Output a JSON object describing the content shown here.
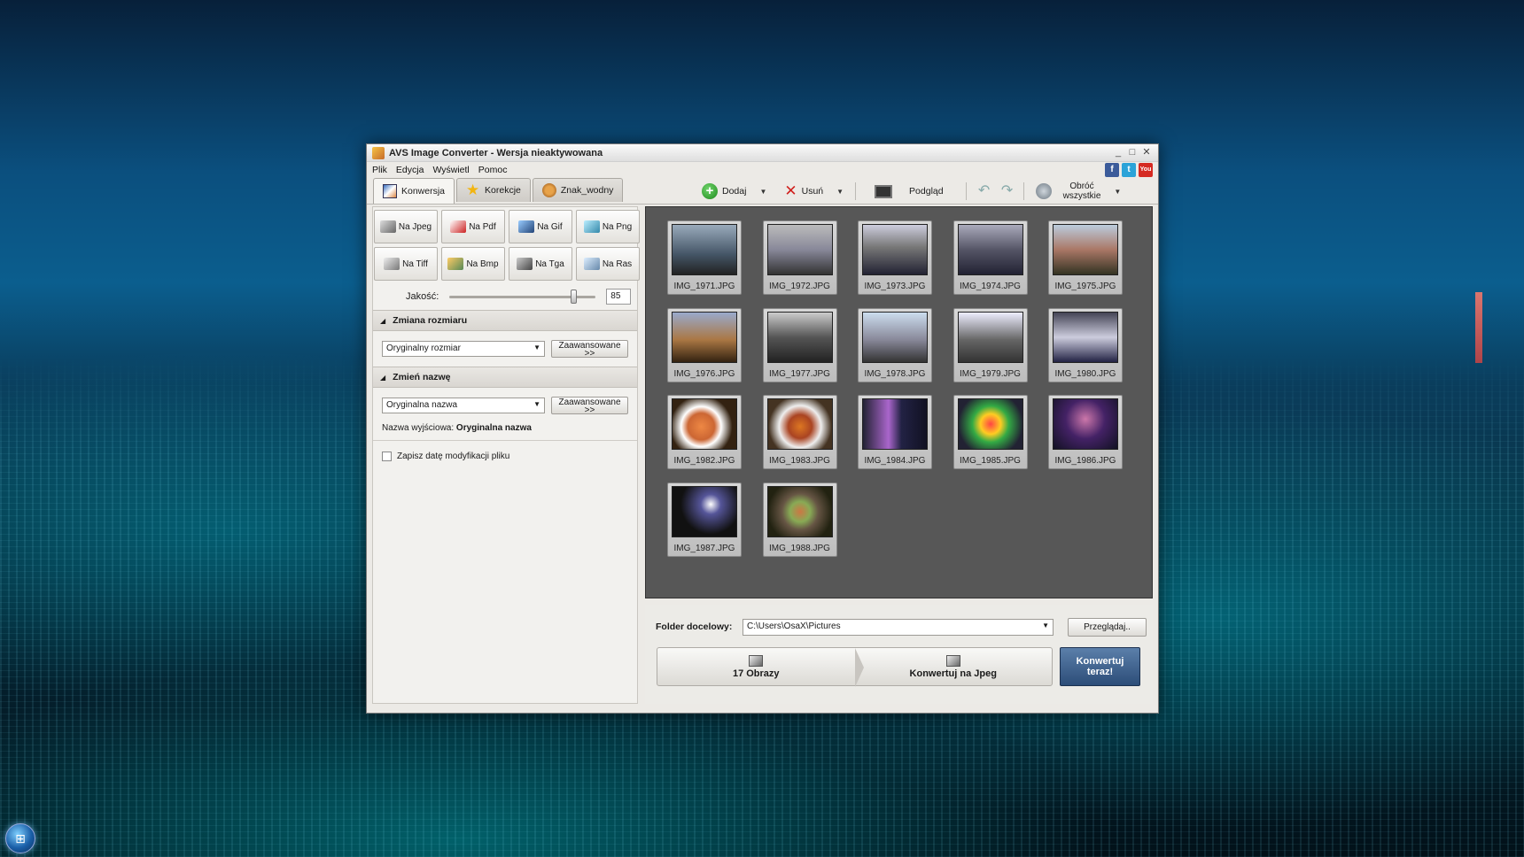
{
  "window": {
    "title": "AVS Image Converter - Wersja nieaktywowana"
  },
  "menu": [
    "Plik",
    "Edycja",
    "Wyświetl",
    "Pomoc"
  ],
  "social": [
    "facebook-icon",
    "twitter-icon",
    "youtube-icon"
  ],
  "tabs": [
    {
      "label": "Konwersja",
      "icon": "convert-icon",
      "active": true
    },
    {
      "label": "Korekcje",
      "icon": "star-icon",
      "active": false
    },
    {
      "label": "Znak_wodny",
      "icon": "stamp-icon",
      "active": false
    }
  ],
  "toolbar": {
    "add_label": "Dodaj",
    "remove_label": "Usuń",
    "preview_label": "Podgląd",
    "rotate_all_label_1": "Obróć",
    "rotate_all_label_2": "wszystkie"
  },
  "formats": [
    "Na Jpeg",
    "Na Pdf",
    "Na Gif",
    "Na Png",
    "Na Tiff",
    "Na Bmp",
    "Na Tga",
    "Na Ras"
  ],
  "quality": {
    "label": "Jakość:",
    "value": "85",
    "level": 0.85
  },
  "resize": {
    "title": "Zmiana rozmiaru",
    "selected": "Oryginalny rozmiar",
    "advanced_1": "Zaawansowane",
    "advanced_2": ">>"
  },
  "rename": {
    "title": "Zmień nazwę",
    "selected": "Oryginalna nazwa",
    "advanced_1": "Zaawansowane",
    "advanced_2": ">>",
    "output_label": "Nazwa wyjściowa:",
    "output_value": "Oryginalna nazwa"
  },
  "keep_date_label": "Zapisz datę modyfikacji pliku",
  "images": [
    "IMG_1971.JPG",
    "IMG_1972.JPG",
    "IMG_1973.JPG",
    "IMG_1974.JPG",
    "IMG_1975.JPG",
    "IMG_1976.JPG",
    "IMG_1977.JPG",
    "IMG_1978.JPG",
    "IMG_1979.JPG",
    "IMG_1980.JPG",
    "IMG_1982.JPG",
    "IMG_1983.JPG",
    "IMG_1984.JPG",
    "IMG_1985.JPG",
    "IMG_1986.JPG",
    "IMG_1987.JPG",
    "IMG_1988.JPG"
  ],
  "destination": {
    "label": "Folder docelowy:",
    "path": "C:\\Users\\OsaX\\Pictures",
    "browse_label": "Przeglądaj.."
  },
  "steps": {
    "count_label": "17 Obrazy",
    "target_label": "Konwertuj na Jpeg"
  },
  "convert": {
    "label_1": "Konwertuj",
    "label_2": "teraz!"
  },
  "colors": {
    "accent": "#2c4d78",
    "thumb_bg": "#575757"
  }
}
